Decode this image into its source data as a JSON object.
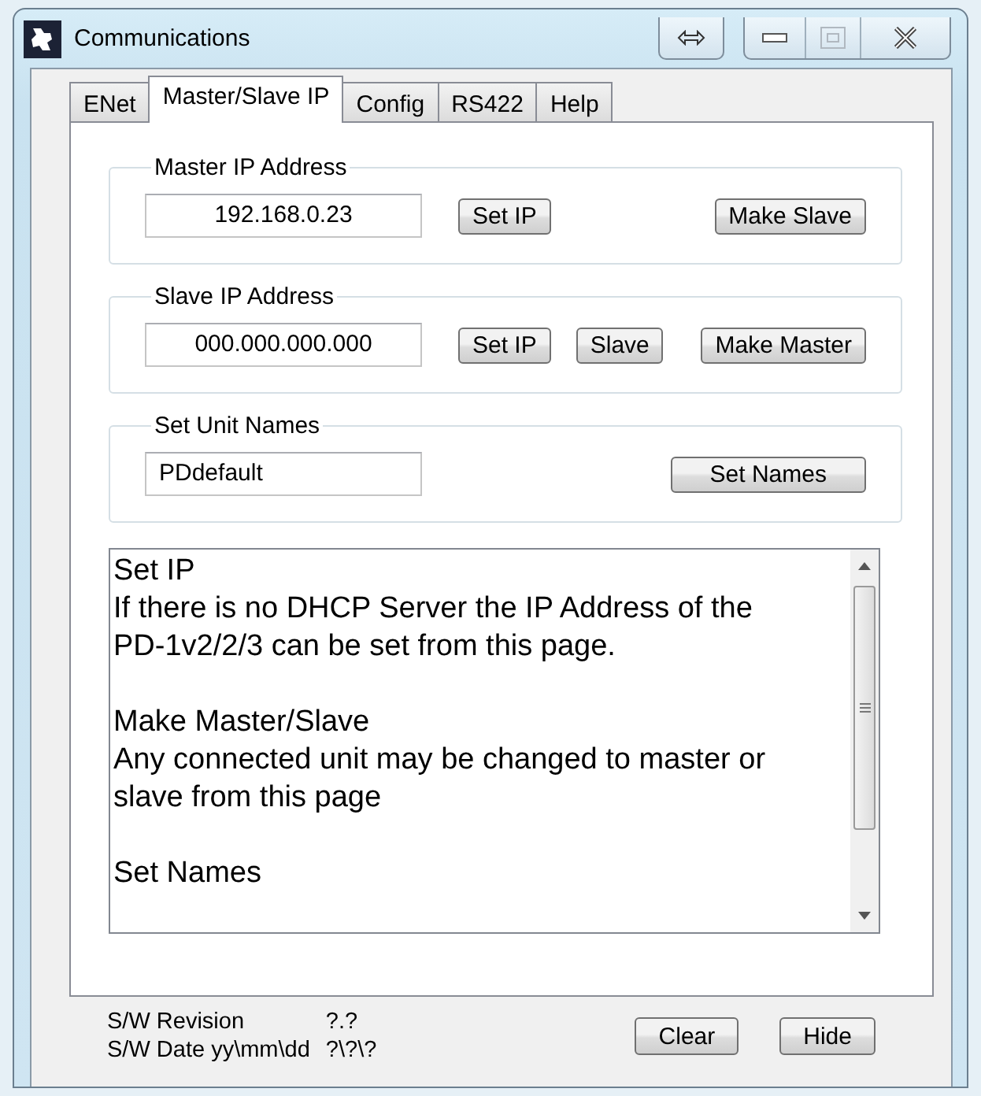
{
  "window": {
    "title": "Communications"
  },
  "tabs": [
    {
      "label": "ENet",
      "selected": false
    },
    {
      "label": "Master/Slave IP",
      "selected": true
    },
    {
      "label": "Config",
      "selected": false
    },
    {
      "label": "RS422",
      "selected": false
    },
    {
      "label": "Help",
      "selected": false
    }
  ],
  "groups": [
    {
      "legend": "Master IP Address",
      "value": "192.168.0.23",
      "kind": "address",
      "buttons": [
        "Set IP",
        "Make Slave"
      ]
    },
    {
      "legend": "Slave IP Address",
      "value": "000.000.000.000",
      "kind": "address",
      "buttons": [
        "Set IP",
        "Slave",
        "Make Master"
      ]
    },
    {
      "legend": "Set Unit Names",
      "value": "PDdefault",
      "kind": "name",
      "buttons": [
        "Set Names"
      ]
    }
  ],
  "help_text": [
    {
      "title": "Set IP",
      "body": "If there is no DHCP Server the IP Address of the PD-1v2/2/3 can be set from this page."
    },
    {
      "title": "Make Master/Slave",
      "body": "Any connected unit may be changed to master or slave from this page"
    },
    {
      "title": "Set Names"
    }
  ],
  "footer": {
    "revision_label": "S/W Revision",
    "revision_value": "?.?",
    "date_label": "S/W Date yy\\mm\\dd",
    "date_value": "?\\?\\?",
    "buttons": [
      "Clear",
      "Hide"
    ]
  }
}
